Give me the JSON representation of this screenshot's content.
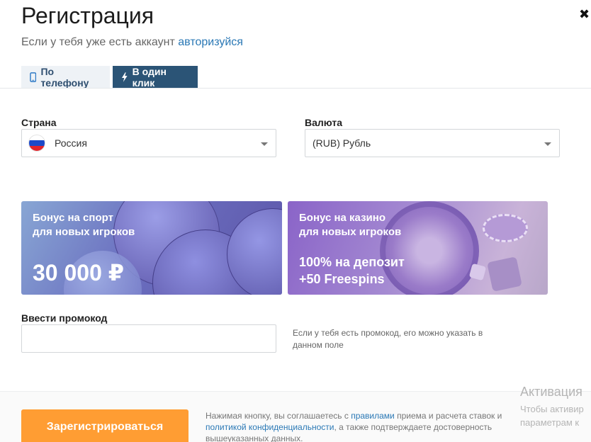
{
  "header": {
    "title": "Регистрация",
    "subtitle_text": "Если у тебя уже есть аккаунт",
    "login_link": "авторизуйся",
    "close_symbol": "✖"
  },
  "tabs": [
    {
      "label": "По телефону",
      "icon": "phone-icon",
      "active": false
    },
    {
      "label": "В один клик",
      "icon": "lightning-icon",
      "active": true
    }
  ],
  "country": {
    "label": "Страна",
    "value": "Россия",
    "flag_colors": [
      "#ffffff",
      "#1c49c9",
      "#e2242b"
    ]
  },
  "currency": {
    "label": "Валюта",
    "value": "(RUB) Рубль"
  },
  "bonus_sport": {
    "title_line1": "Бонус на спорт",
    "title_line2": "для новых игроков",
    "amount": "30 000 ₽"
  },
  "bonus_casino": {
    "title_line1": "Бонус на казино",
    "title_line2": "для новых игроков",
    "offer_line1": "100% на депозит",
    "offer_line2": "+50 Freespins"
  },
  "promo": {
    "label": "Ввести промокод",
    "value": "",
    "placeholder": "",
    "hint": "Если у тебя есть промокод, его можно указать в данном поле"
  },
  "footer": {
    "register_button": "Зарегистрироваться",
    "agree_prefix": "Нажимая кнопку, вы соглашаетесь с",
    "rules_link": "правилами",
    "agree_middle": "приема и расчета ставок и",
    "privacy_link": "политикой конфиденциальности",
    "agree_suffix": ", а также подтверждаете достоверность вышеуказанных данных."
  },
  "watermark": {
    "line1": "Активация",
    "line2": "Чтобы активир",
    "line3": "параметрам к"
  },
  "colors": {
    "accent_button": "#ff9d33",
    "active_tab": "#2b5476",
    "link": "#2a78b5"
  }
}
